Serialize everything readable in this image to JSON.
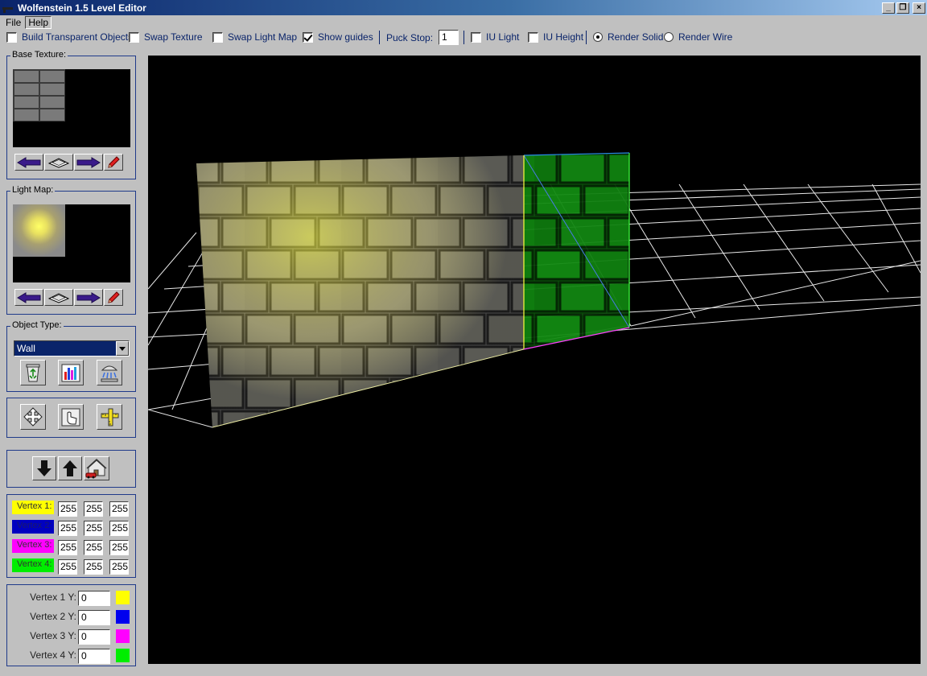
{
  "window": {
    "title": "Wolfenstein 1.5 Level Editor",
    "controls": [
      "_",
      "❐",
      "×"
    ]
  },
  "menu": {
    "items": [
      "File",
      "Help"
    ]
  },
  "toolbar": {
    "build_transparent": {
      "label": "Build Transparent Objects",
      "checked": false
    },
    "swap_texture": {
      "label": "Swap Texture",
      "checked": false
    },
    "swap_light_map": {
      "label": "Swap Light Map",
      "checked": false
    },
    "show_guides": {
      "label": "Show guides",
      "checked": true
    },
    "puck_stop_label": "Puck Stop:",
    "puck_stop_value": "1",
    "iu_light": {
      "label": "IU Light",
      "checked": false
    },
    "iu_height": {
      "label": "IU Height",
      "checked": false
    },
    "render_solid": {
      "label": "Render Solid",
      "selected": true
    },
    "render_wire": {
      "label": "Render Wire",
      "selected": false
    }
  },
  "base_texture": {
    "label": "Base Texture:"
  },
  "light_map": {
    "label": "Light Map:"
  },
  "object_type": {
    "label": "Object Type:",
    "selected": "Wall"
  },
  "vertex_colors": [
    {
      "label": "Vertex 1:",
      "color": "#ffff00",
      "r": "255",
      "g": "255",
      "b": "255"
    },
    {
      "label": "Vertex 2:",
      "color": "#0000c0",
      "r": "255",
      "g": "255",
      "b": "255"
    },
    {
      "label": "Vertex 3:",
      "color": "#ff00ff",
      "r": "255",
      "g": "255",
      "b": "255"
    },
    {
      "label": "Vertex 4:",
      "color": "#00ee00",
      "r": "255",
      "g": "255",
      "b": "255"
    }
  ],
  "vertex_y": [
    {
      "label": "Vertex 1 Y:",
      "value": "0",
      "color": "#ffff00"
    },
    {
      "label": "Vertex 2 Y:",
      "value": "0",
      "color": "#0000ee"
    },
    {
      "label": "Vertex 3 Y:",
      "value": "0",
      "color": "#ff00ff"
    },
    {
      "label": "Vertex 4 Y:",
      "value": "0",
      "color": "#00ee00"
    }
  ],
  "colors": {
    "title_bar": "#0a246a",
    "frame": "#c0c0c0",
    "viewport": "#000000",
    "wall_highlight": "#1a8a1a"
  }
}
